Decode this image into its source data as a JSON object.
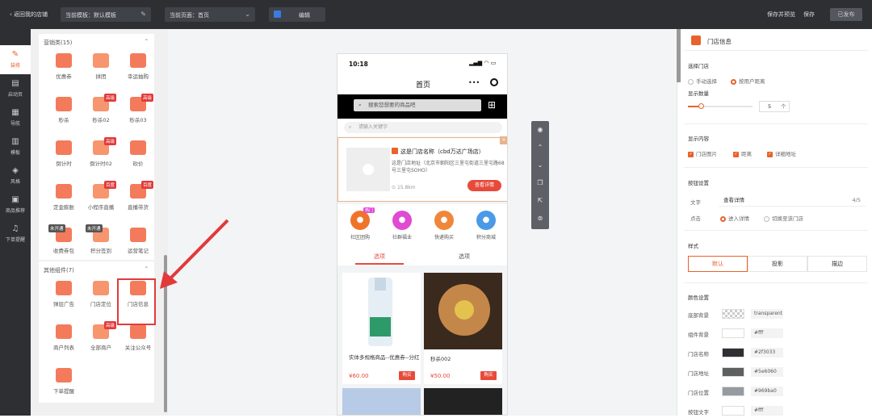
{
  "topbar": {
    "back": "返回我的店铺",
    "template_label": "当前模板：默认模板",
    "page_label": "当前页面：首页",
    "edit": "编辑",
    "save_preview": "保存并预览",
    "save": "保存",
    "publish": "已发布"
  },
  "nav": [
    {
      "label": "装修",
      "icon": "brush-icon",
      "glyph": "✎"
    },
    {
      "label": "启动页",
      "icon": "launch-page-icon",
      "glyph": "▤"
    },
    {
      "label": "导航",
      "icon": "grid-nav-icon",
      "glyph": "▦"
    },
    {
      "label": "模板",
      "icon": "template-icon",
      "glyph": "▥"
    },
    {
      "label": "风格",
      "icon": "style-icon",
      "glyph": "◈"
    },
    {
      "label": "商品推荐",
      "icon": "recommend-icon",
      "glyph": "▣"
    },
    {
      "label": "下单提醒",
      "icon": "bell-icon",
      "glyph": "♫"
    }
  ],
  "marketing": {
    "title": "营销类(15)",
    "items": [
      {
        "label": "优惠券",
        "badge": "",
        "color": "#f06f4a"
      },
      {
        "label": "拼团",
        "badge": "",
        "color": "#f06f4a"
      },
      {
        "label": "幸运抽购",
        "badge": "",
        "color": "#f06f4a"
      },
      {
        "label": "秒杀",
        "badge": "",
        "color": "#f06f4a"
      },
      {
        "label": "秒杀02",
        "badge": "高级",
        "color": "#f06f4a"
      },
      {
        "label": "秒杀03",
        "badge": "高级",
        "color": "#f06f4a"
      },
      {
        "label": "倒计时",
        "badge": "",
        "color": "#f06f4a"
      },
      {
        "label": "倒计时02",
        "badge": "高级",
        "color": "#f06f4a"
      },
      {
        "label": "砍价",
        "badge": "",
        "color": "#f06f4a"
      },
      {
        "label": "定金膨胀",
        "badge": "",
        "color": "#f06f4a"
      },
      {
        "label": "小程序直播",
        "badge": "百度",
        "color": "#f06f4a"
      },
      {
        "label": "直播带货",
        "badge": "百度",
        "color": "#f06f4a"
      },
      {
        "label": "收费券包",
        "badge": "未开通",
        "color": "#f06f4a"
      },
      {
        "label": "积分签到",
        "badge": "未开通",
        "color": "#f06f4a"
      },
      {
        "label": "运营笔记",
        "badge": "",
        "color": "#f06f4a"
      }
    ]
  },
  "other": {
    "title": "其他组件(7)",
    "items": [
      {
        "label": "弹层广告",
        "badge": ""
      },
      {
        "label": "门店定位",
        "badge": ""
      },
      {
        "label": "门店信息",
        "badge": ""
      },
      {
        "label": "商户列表",
        "badge": ""
      },
      {
        "label": "全部商户",
        "badge": "高级"
      },
      {
        "label": "关注公众号",
        "badge": ""
      },
      {
        "label": "下单提醒",
        "badge": ""
      }
    ]
  },
  "phone": {
    "time": "10:18",
    "title": "首页",
    "search_placeholder": "搜索您想要的商品吧",
    "keyword_placeholder": "请输入关键字",
    "store": {
      "name": "这是门店名称（cbd万达广场店）",
      "address": "这是门店地址（北京市朝阳区三里屯街道三里屯路68号三里屯SOHO）",
      "distance": "15.8km",
      "button": "查看详情"
    },
    "quick": [
      {
        "label": "社区团购",
        "color": "#f0732a",
        "hot": "热门"
      },
      {
        "label": "社群福业",
        "color": "#e04bd3",
        "hot": ""
      },
      {
        "label": "快递购买",
        "color": "#f0863a",
        "hot": ""
      },
      {
        "label": "积分商城",
        "color": "#4a9ae8",
        "hot": ""
      }
    ],
    "tabs": [
      "选项",
      "选项"
    ],
    "products": [
      {
        "name": "实体多规格商品--优惠券--分红",
        "price": "¥60.00",
        "buy": "购买"
      },
      {
        "name": "秒杀002",
        "price": "¥50.00",
        "buy": "购买"
      }
    ]
  },
  "right": {
    "title": "门店信息",
    "select_store": "选择门店",
    "manual": "手动选择",
    "by_distance": "按用户距离",
    "display_count": "显示数量",
    "count_value": "5",
    "count_unit": "个",
    "display_content": "显示内容",
    "content_opts": [
      "门店图片",
      "距离",
      "详细地址"
    ],
    "button_settings": "按钮设置",
    "text_label": "文字",
    "text_value": "查看详情",
    "text_count": "4/5",
    "click_label": "点击",
    "go_detail": "进入详情",
    "switch_store": "切换至该门店",
    "style": "样式",
    "style_opts": [
      "默认",
      "投影",
      "描边"
    ],
    "color_settings": "颜色设置",
    "colors": [
      {
        "label": "底部背景",
        "hex": "transparent"
      },
      {
        "label": "组件背景",
        "hex": "#fff"
      },
      {
        "label": "门店名称",
        "hex": "#2f3033"
      },
      {
        "label": "门店地址",
        "hex": "#5e6060"
      },
      {
        "label": "门店位置",
        "hex": "#969ba0"
      },
      {
        "label": "按钮文字",
        "hex": "#fff"
      }
    ]
  }
}
